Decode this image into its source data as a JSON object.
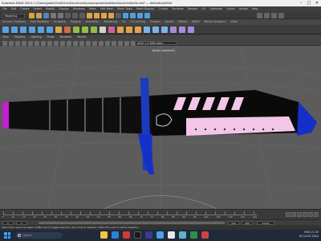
{
  "titlebar": {
    "title": "Autodesk MAYA 2024: C:\\Users\\gabd\\OneDrive\\Documents\\maya\\projects\\default\\scenes\\Knife.mb* --- defaultLightSet",
    "minimize": "–",
    "maximize": "□",
    "close": "✕"
  },
  "menubar": {
    "items": [
      "File",
      "Edit",
      "Create",
      "Select",
      "Modify",
      "Display",
      "Windows",
      "Mesh",
      "Edit Mesh",
      "Mesh Tools",
      "Mesh Display",
      "Curves",
      "Surfaces",
      "Deform",
      "UV",
      "Generate",
      "Cache",
      "Arnold",
      "Help"
    ]
  },
  "statusline": {
    "mode": "Modeling"
  },
  "shelf_tabs": {
    "items": [
      "Curves / Surfaces",
      "Poly Modeling",
      "Sculpting",
      "Rigging",
      "Animation",
      "Rendering",
      "FX",
      "FX Caching",
      "Custom",
      "Arnold",
      "Bifrost",
      "MASH",
      "Motion Graphics",
      "XGen"
    ]
  },
  "panel_menu": {
    "items": [
      "View",
      "Shading",
      "Lighting",
      "Show",
      "Renderer",
      "Panels"
    ]
  },
  "panel_toolbar": {
    "colorspace": "ACES 1.0 SDR-video"
  },
  "viewport": {
    "camera_label": "persp (camera1)"
  },
  "timeslider": {
    "ticks": [
      "5",
      "10",
      "15",
      "20",
      "25",
      "30",
      "35",
      "40",
      "45",
      "50",
      "55",
      "60",
      "65",
      "70",
      "75",
      "80",
      "85",
      "90",
      "95",
      "100",
      "105",
      "110",
      "115",
      "120"
    ]
  },
  "rangebar": {
    "start": "1",
    "end": "120",
    "range_end": "200",
    "fps": "24 fps"
  },
  "helpline": {
    "text": "Select Tool: select an object. Shift+click to toggle selection, Ctrl+click to deselect. Shift+Ctrl+click to add to selection."
  },
  "taskbar": {
    "search_placeholder": "Search",
    "tray_lang": "ENG",
    "tray_region": "IN",
    "time": "21:35",
    "date": "12-03-2024"
  },
  "colors": {
    "knife_blade": "#0a0a0a",
    "knife_highlight": "#f3c6e8",
    "knife_edge_blue": "#1530c9",
    "handle_tip": "#c21fd0"
  }
}
